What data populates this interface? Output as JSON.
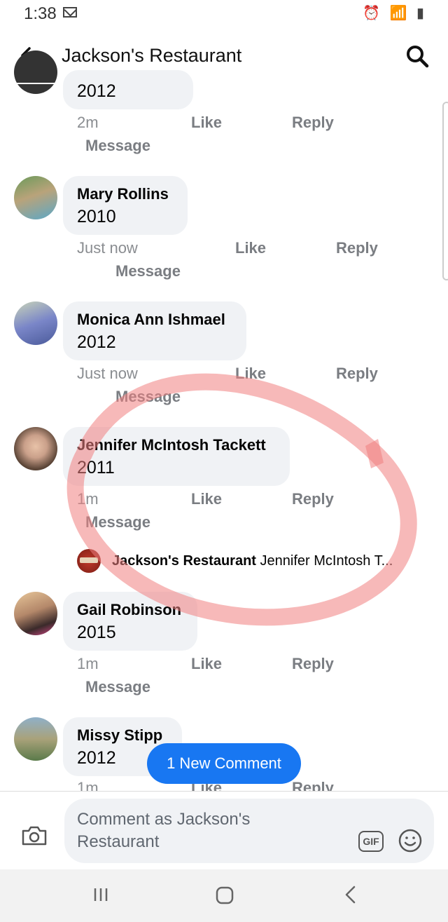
{
  "status_bar": {
    "time": "1:38",
    "icons": "⏰ 📶 ▮"
  },
  "header": {
    "title": "Jackson's Restaurant"
  },
  "comments": [
    {
      "name": "",
      "text": "2012",
      "time": "2m",
      "like": "Like",
      "reply": "Reply",
      "message": "Message"
    },
    {
      "name": "Mary Rollins",
      "text": "2010",
      "time": "Just now",
      "like": "Like",
      "reply": "Reply",
      "message": "Message"
    },
    {
      "name": "Monica Ann Ishmael",
      "text": "2012",
      "time": "Just now",
      "like": "Like",
      "reply": "Reply",
      "message": "Message"
    },
    {
      "name": "Jennifer McIntosh Tackett",
      "text": "2011",
      "time": "1m",
      "like": "Like",
      "reply": "Reply",
      "message": "Message"
    },
    {
      "name": "Gail Robinson",
      "text": "2015",
      "time": "1m",
      "like": "Like",
      "reply": "Reply",
      "message": "Message"
    },
    {
      "name": "Missy Stipp",
      "text": "2012",
      "time": "1m",
      "like": "Like",
      "reply": "Reply"
    }
  ],
  "page_reply": {
    "name": "Jackson's Restaurant",
    "text": "Jennifer McIntosh T..."
  },
  "new_comment_button": "1 New Comment",
  "composer": {
    "placeholder": "Comment as Jackson's Restaurant",
    "gif_label": "GIF"
  },
  "colors": {
    "accent": "#1877f2",
    "annotation_circle": "#f08080"
  }
}
